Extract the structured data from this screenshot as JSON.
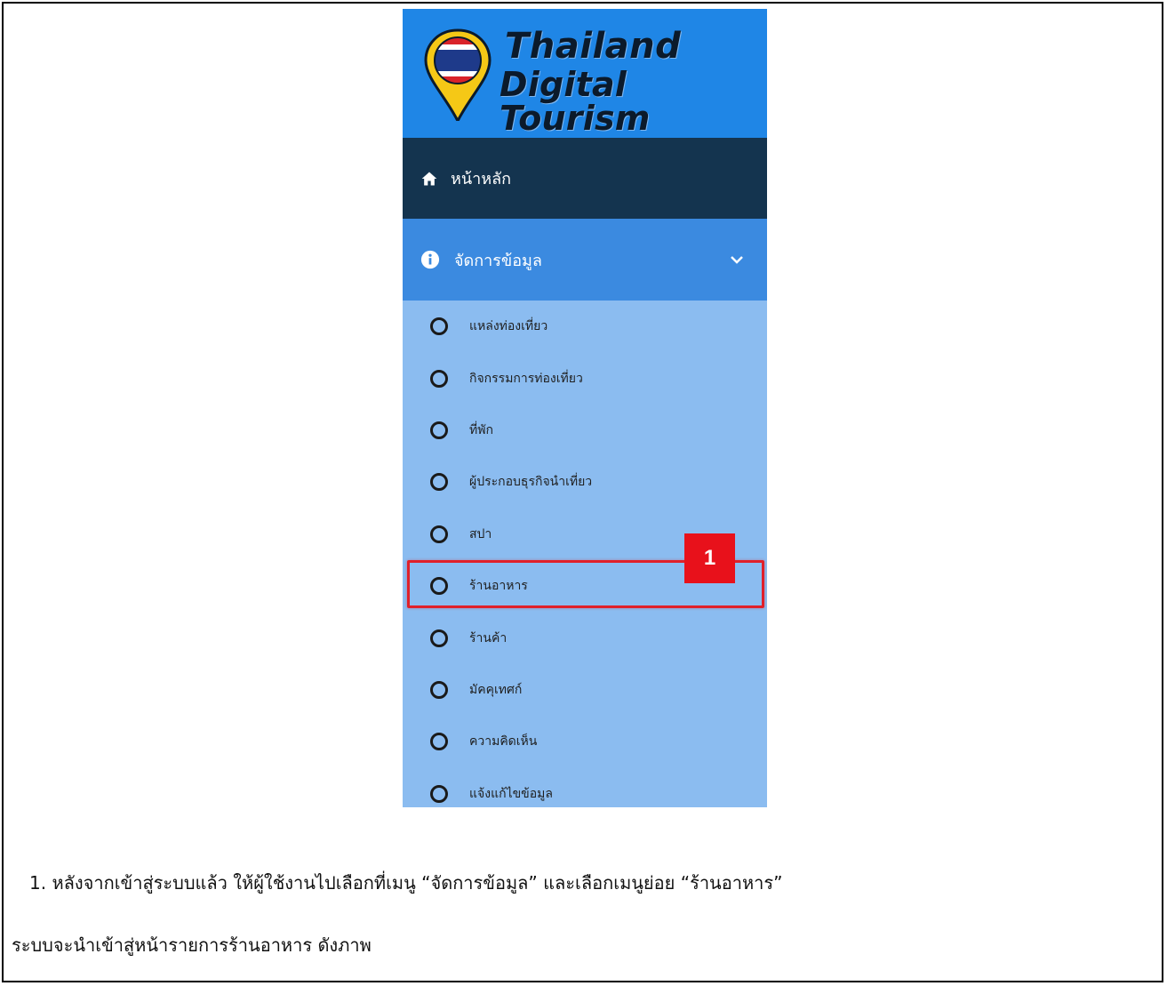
{
  "logo": {
    "line1": "Thailand",
    "line2": "Digital Tourism"
  },
  "menu": {
    "home_label": "หน้าหลัก",
    "manage_label": "จัดการข้อมูล",
    "submenu": [
      "แหล่งท่องเที่ยว",
      "กิจกรรมการท่องเที่ยว",
      "ที่พัก",
      "ผู้ประกอบธุรกิจนำเที่ยว",
      "สปา",
      "ร้านอาหาร",
      "ร้านค้า",
      "มัคคุเทศก์",
      "ความคิดเห็น",
      "แจ้งแก้ไขข้อมูล"
    ]
  },
  "callout": {
    "number": "1"
  },
  "caption": {
    "line1": "1. หลังจากเข้าสู่ระบบแล้ว ให้ผู้ใช้งานไปเลือกที่เมนู “จัดการข้อมูล” และเลือกเมนูย่อย “ร้านอาหาร”",
    "line2": "ระบบจะนำเข้าสู่หน้ารายการร้านอาหาร ดังภาพ"
  },
  "colors": {
    "logo_bg": "#1f86e6",
    "home_bg": "#14344f",
    "manage_bg": "#3b8ae0",
    "submenu_bg": "#8bbcf0",
    "highlight": "#e0202a"
  }
}
